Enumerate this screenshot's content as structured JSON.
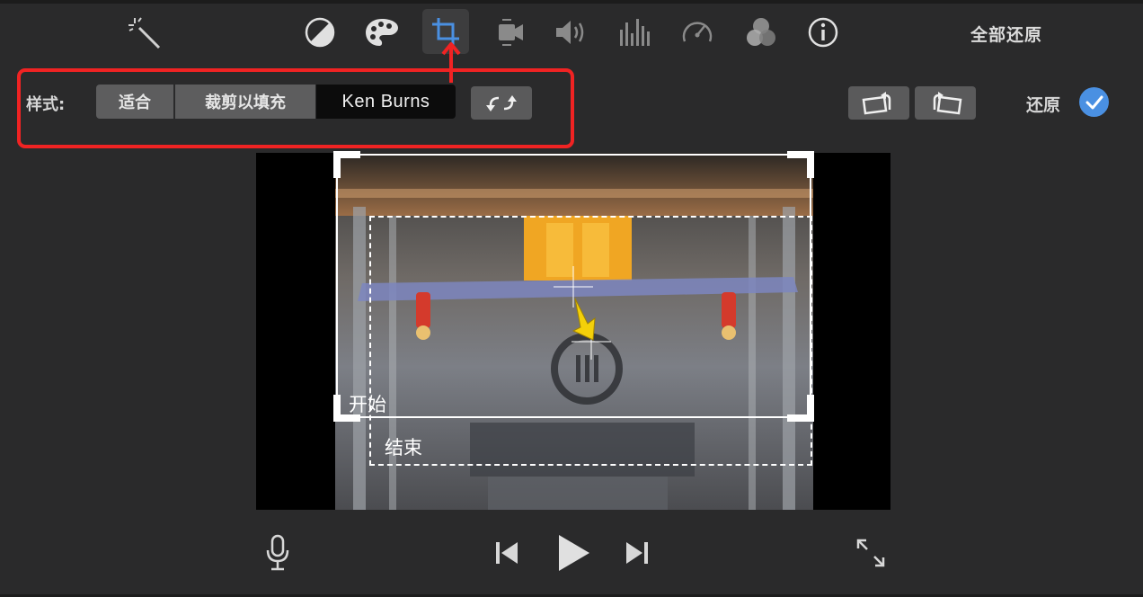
{
  "toolbar": {
    "icons": [
      "magic-wand-icon",
      "color-balance-icon",
      "color-correction-icon",
      "crop-icon",
      "stabilization-icon",
      "volume-icon",
      "noise-eq-icon",
      "speed-icon",
      "clip-filter-icon",
      "info-icon"
    ],
    "selected": "crop-icon",
    "reset_all_label": "全部还原"
  },
  "crop_panel": {
    "style_label": "样式:",
    "styles": [
      "适合",
      "裁剪以填充",
      "Ken Burns"
    ],
    "selected_style": "Ken Burns",
    "swap_icon": "swap-start-end-icon"
  },
  "right_controls": {
    "rotate_left_icon": "rotate-left-icon",
    "rotate_right_icon": "rotate-right-icon",
    "reset_label": "还原",
    "apply_icon": "checkmark-icon"
  },
  "viewer": {
    "start_label": "开始",
    "end_label": "结束"
  },
  "playback": {
    "icons": [
      "microphone-icon",
      "skip-back-icon",
      "play-icon",
      "skip-forward-icon",
      "fullscreen-icon"
    ]
  },
  "colors": {
    "background": "#2a2a2b",
    "accent": "#4a90e2",
    "highlight_red": "#f02323",
    "button_gray": "#5d5d5e"
  }
}
